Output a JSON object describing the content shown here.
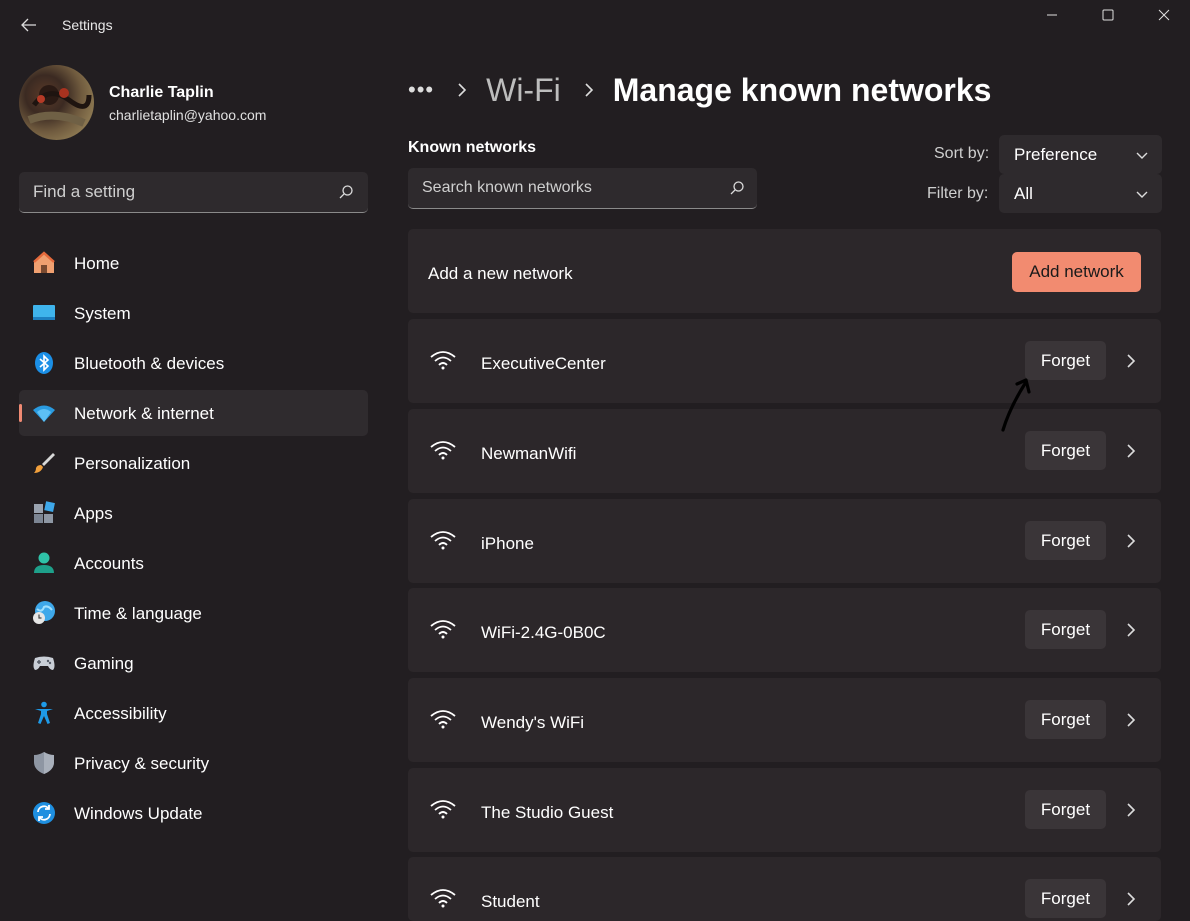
{
  "app": {
    "title": "Settings"
  },
  "profile": {
    "name": "Charlie Taplin",
    "email": "charlietaplin@yahoo.com"
  },
  "search": {
    "placeholder": "Find a setting"
  },
  "sidebar": {
    "items": [
      {
        "label": "Home",
        "icon": "home-icon"
      },
      {
        "label": "System",
        "icon": "system-icon"
      },
      {
        "label": "Bluetooth & devices",
        "icon": "bluetooth-icon"
      },
      {
        "label": "Network & internet",
        "icon": "network-icon",
        "active": true
      },
      {
        "label": "Personalization",
        "icon": "brush-icon"
      },
      {
        "label": "Apps",
        "icon": "apps-icon"
      },
      {
        "label": "Accounts",
        "icon": "accounts-icon"
      },
      {
        "label": "Time & language",
        "icon": "time-language-icon"
      },
      {
        "label": "Gaming",
        "icon": "gaming-icon"
      },
      {
        "label": "Accessibility",
        "icon": "accessibility-icon"
      },
      {
        "label": "Privacy & security",
        "icon": "shield-icon"
      },
      {
        "label": "Windows Update",
        "icon": "update-icon"
      }
    ]
  },
  "breadcrumb": {
    "more": "•••",
    "parent": "Wi-Fi",
    "current": "Manage known networks"
  },
  "known": {
    "label": "Known networks",
    "search_placeholder": "Search known networks",
    "sort_label": "Sort by:",
    "sort_value": "Preference",
    "filter_label": "Filter by:",
    "filter_value": "All"
  },
  "add_network": {
    "text": "Add a new network",
    "button": "Add network"
  },
  "networks": [
    {
      "name": "ExecutiveCenter",
      "action": "Forget"
    },
    {
      "name": "NewmanWifi",
      "action": "Forget"
    },
    {
      "name": "iPhone",
      "action": "Forget"
    },
    {
      "name": "WiFi-2.4G-0B0C",
      "action": "Forget"
    },
    {
      "name": "Wendy's WiFi",
      "action": "Forget"
    },
    {
      "name": "The Studio Guest",
      "action": "Forget"
    },
    {
      "name": "Student",
      "action": "Forget"
    }
  ],
  "colors": {
    "accent": "#f28b70",
    "background": "#221e21",
    "card": "#2c272a"
  }
}
